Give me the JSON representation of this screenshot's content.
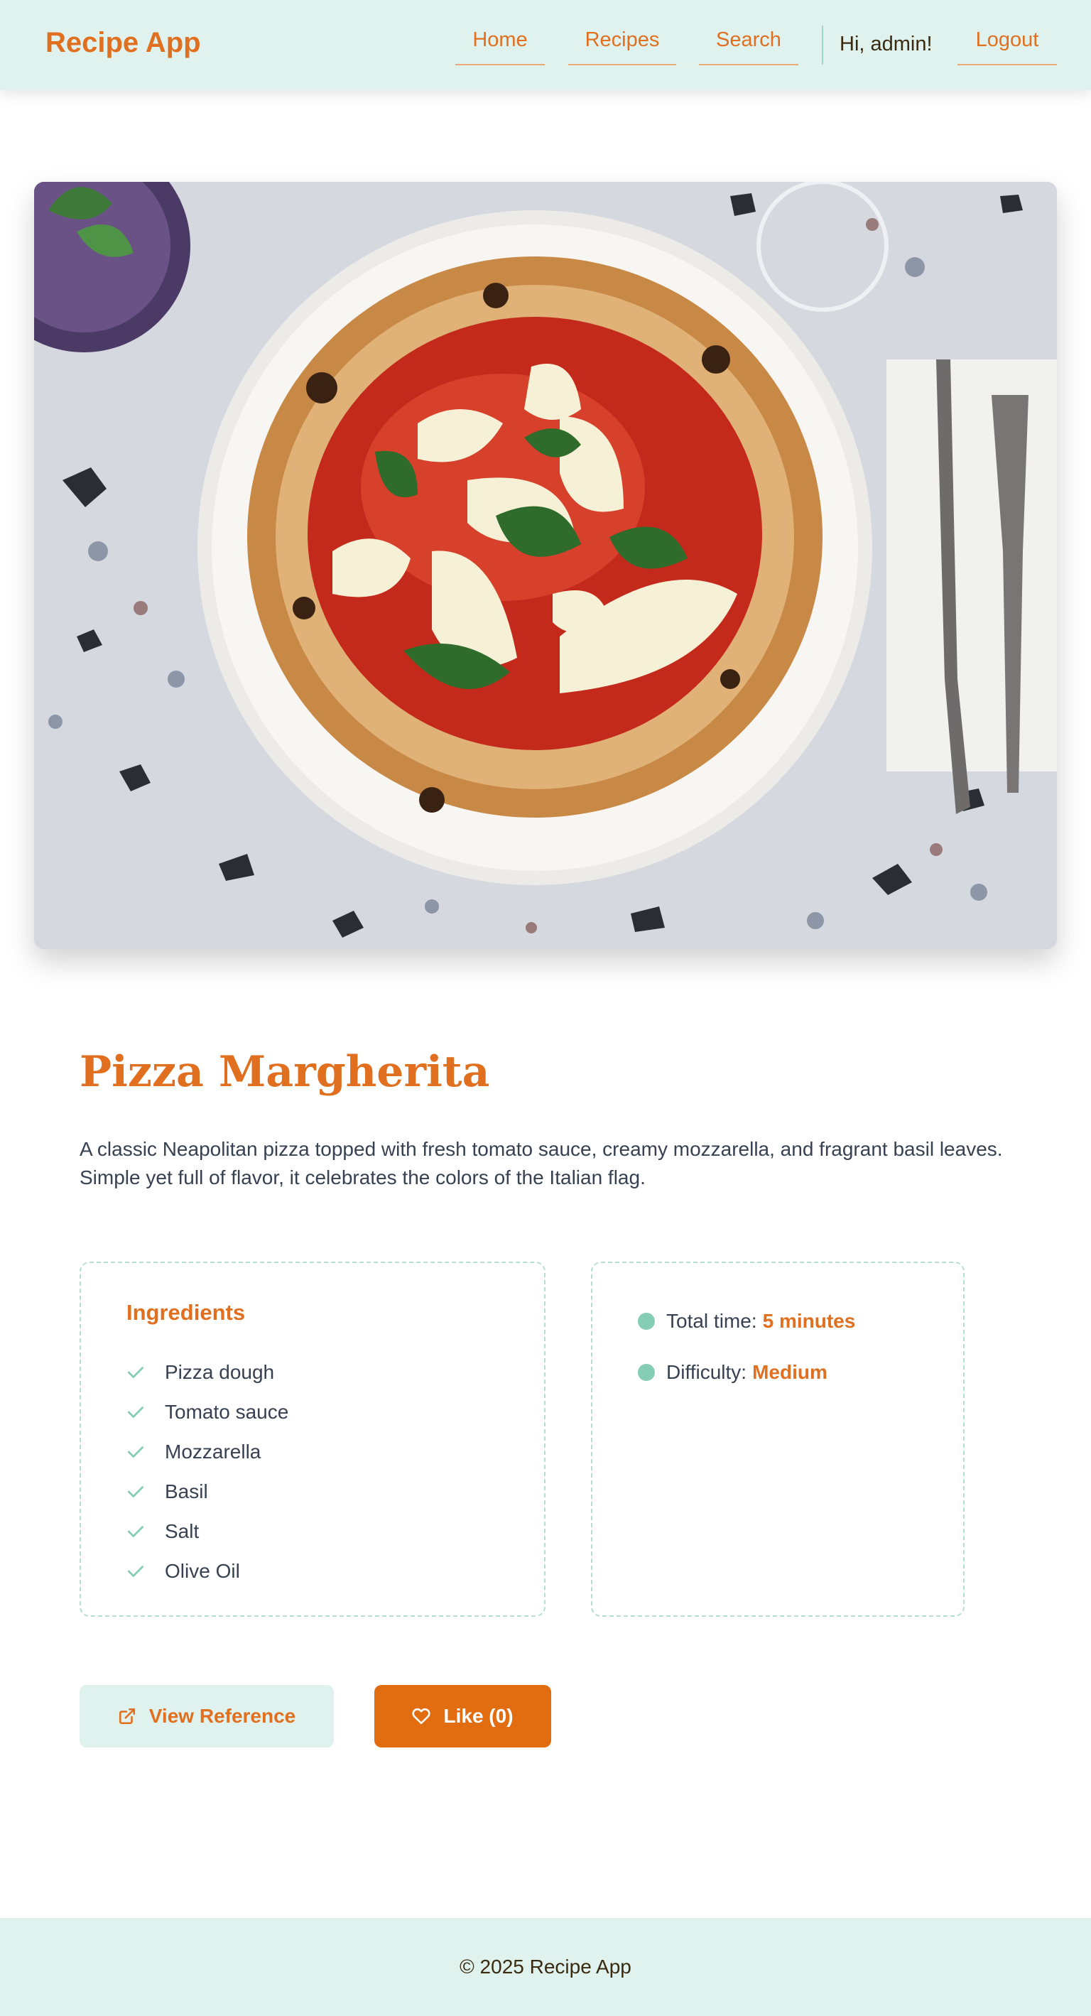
{
  "header": {
    "logo": "Recipe App",
    "nav": {
      "home": "Home",
      "recipes": "Recipes",
      "search": "Search"
    },
    "greeting": "Hi, admin!",
    "logout": "Logout"
  },
  "recipe": {
    "image_alt": "Pizza Margherita on a white plate with knife and fork",
    "title": "Pizza Margherita",
    "description": "A classic Neapolitan pizza topped with fresh tomato sauce, creamy mozzarella, and fragrant basil leaves. Simple yet full of flavor, it celebrates the colors of the Italian flag.",
    "ingredients_heading": "Ingredients",
    "ingredients": [
      "Pizza dough",
      "Tomato sauce",
      "Mozzarella",
      "Basil",
      "Salt",
      "Olive Oil"
    ],
    "total_time_label": "Total time:",
    "total_time_value": "5 minutes",
    "difficulty_label": "Difficulty:",
    "difficulty_value": "Medium"
  },
  "actions": {
    "view_reference": "View Reference",
    "like": "Like (0)"
  },
  "footer": {
    "text": "© 2025 Recipe App"
  },
  "icons": {
    "external_link": "external-link-icon",
    "heart": "heart-icon",
    "check": "check-icon"
  },
  "colors": {
    "accent": "#e07020",
    "mint": "#e0f2ee",
    "like_button": "#e26d10",
    "check": "#86cdb6"
  }
}
